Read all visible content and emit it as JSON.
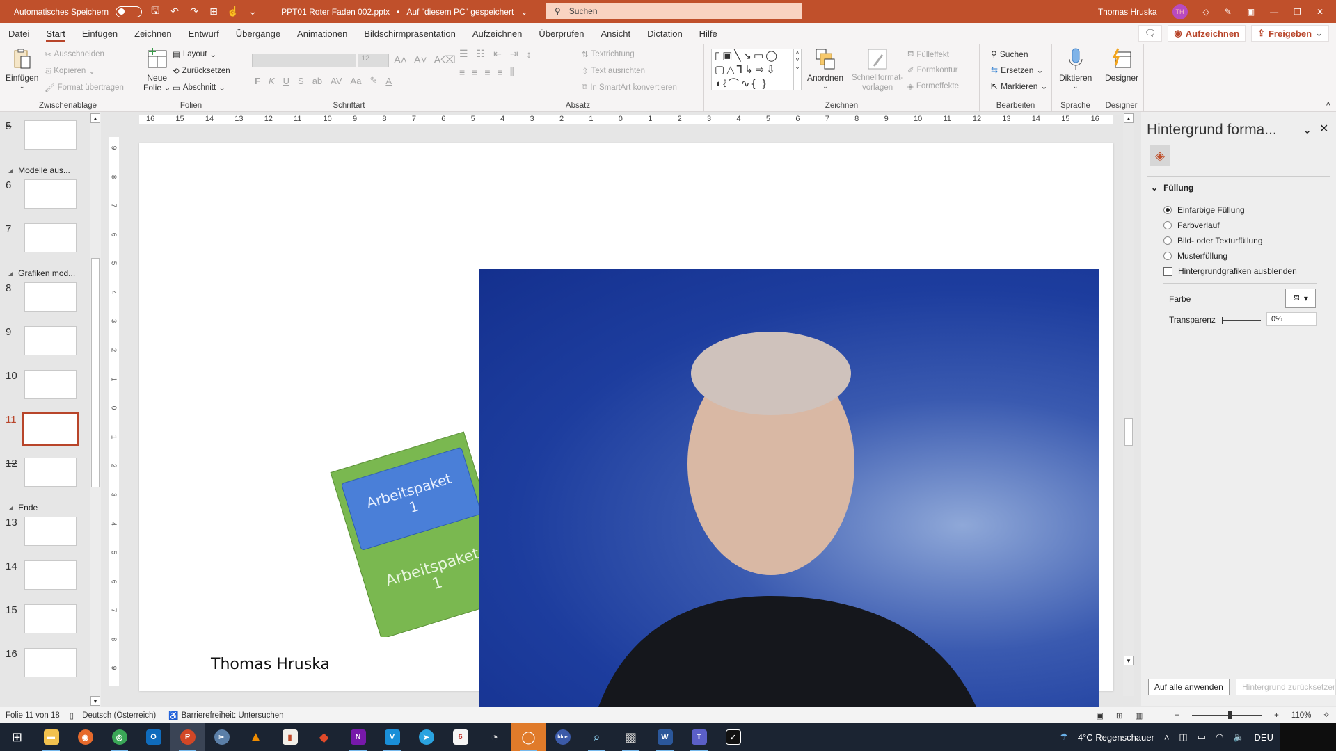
{
  "titlebar": {
    "autosave_label": "Automatisches Speichern",
    "doc_title": "PPT01 Roter Faden 002.pptx",
    "save_location": "Auf \"diesem PC\" gespeichert",
    "search_placeholder": "Suchen",
    "user_name": "Thomas Hruska",
    "user_initials": "TH"
  },
  "menu": {
    "tabs": [
      "Datei",
      "Start",
      "Einfügen",
      "Zeichnen",
      "Entwurf",
      "Übergänge",
      "Animationen",
      "Bildschirmpräsentation",
      "Aufzeichnen",
      "Überprüfen",
      "Ansicht",
      "Dictation",
      "Hilfe"
    ],
    "active_tab": "Start",
    "record_button": "Aufzeichnen",
    "share_button": "Freigeben"
  },
  "ribbon": {
    "clipboard": {
      "label": "Zwischenablage",
      "paste": "Einfügen",
      "cut": "Ausschneiden",
      "copy": "Kopieren",
      "format_painter": "Format übertragen"
    },
    "slides": {
      "label": "Folien",
      "new_slide_1": "Neue",
      "new_slide_2": "Folie",
      "layout": "Layout",
      "reset": "Zurücksetzen",
      "section": "Abschnitt"
    },
    "font": {
      "label": "Schriftart",
      "font_name": "",
      "font_size": "12",
      "bold": "F",
      "italic": "K",
      "underline": "U",
      "shadow": "S",
      "strike": "ab",
      "spacing": "AV",
      "case": "Aa"
    },
    "paragraph": {
      "label": "Absatz",
      "text_direction": "Textrichtung",
      "align_text": "Text ausrichten",
      "smartart": "In SmartArt konvertieren"
    },
    "drawing": {
      "label": "Zeichnen",
      "arrange": "Anordnen",
      "quick_styles_1": "Schnellformat-",
      "quick_styles_2": "vorlagen",
      "fill": "Fülleffekt",
      "outline": "Formkontur",
      "effects": "Formeffekte"
    },
    "editing": {
      "label": "Bearbeiten",
      "find": "Suchen",
      "replace": "Ersetzen",
      "select": "Markieren"
    },
    "voice": {
      "label": "Sprache",
      "dictate": "Diktieren"
    },
    "designer": {
      "label": "Designer",
      "designer": "Designer"
    }
  },
  "slides_pane": {
    "items": [
      {
        "num": "5",
        "hidden": true
      },
      {
        "section": "Modelle aus..."
      },
      {
        "num": "6"
      },
      {
        "num": "7",
        "hidden": true
      },
      {
        "section": "Grafiken mod..."
      },
      {
        "num": "8"
      },
      {
        "num": "9"
      },
      {
        "num": "10"
      },
      {
        "num": "11",
        "selected": true
      },
      {
        "num": "12",
        "hidden": true
      },
      {
        "section": "Ende"
      },
      {
        "num": "13"
      },
      {
        "num": "14"
      },
      {
        "num": "15"
      },
      {
        "num": "16"
      }
    ]
  },
  "ruler": {
    "horizontal": [
      "16",
      "15",
      "14",
      "13",
      "12",
      "11",
      "10",
      "9",
      "8",
      "7",
      "6",
      "5",
      "4",
      "3",
      "2",
      "1",
      "0",
      "1",
      "2",
      "3",
      "4",
      "5",
      "6",
      "7",
      "8",
      "9",
      "10",
      "11",
      "12",
      "13",
      "14",
      "15",
      "16"
    ],
    "vertical": [
      "9",
      "8",
      "7",
      "6",
      "5",
      "4",
      "3",
      "2",
      "1",
      "0",
      "1",
      "2",
      "3",
      "4",
      "5",
      "6",
      "7",
      "8",
      "9"
    ]
  },
  "slide": {
    "blocks": [
      {
        "label": "Arbeitspaket\n1",
        "color": "#4a7fd8"
      },
      {
        "label": "Arbeitspaket\n1",
        "color": "#7ab850"
      }
    ],
    "signature": "Thomas Hruska"
  },
  "format_panel": {
    "title": "Hintergrund forma...",
    "section": "Füllung",
    "options": [
      "Einfarbige Füllung",
      "Farbverlauf",
      "Bild- oder Texturfüllung",
      "Musterfüllung"
    ],
    "selected_option": "Einfarbige Füllung",
    "hide_graphics": "Hintergrundgrafiken ausblenden",
    "color_label": "Farbe",
    "transparency_label": "Transparenz",
    "transparency_value": "0%",
    "apply_all": "Auf alle anwenden",
    "reset_bg": "Hintergrund zurücksetzen"
  },
  "statusbar": {
    "slide_info": "Folie 11 von 18",
    "language": "Deutsch (Österreich)",
    "accessibility": "Barrierefreiheit: Untersuchen",
    "zoom": "110%"
  },
  "taskbar": {
    "weather": "4°C  Regenschauer",
    "lang": "DEU"
  },
  "colors": {
    "accent": "#b8452a",
    "titlebar": "#c0502b",
    "taskbar": "#1b2432"
  }
}
